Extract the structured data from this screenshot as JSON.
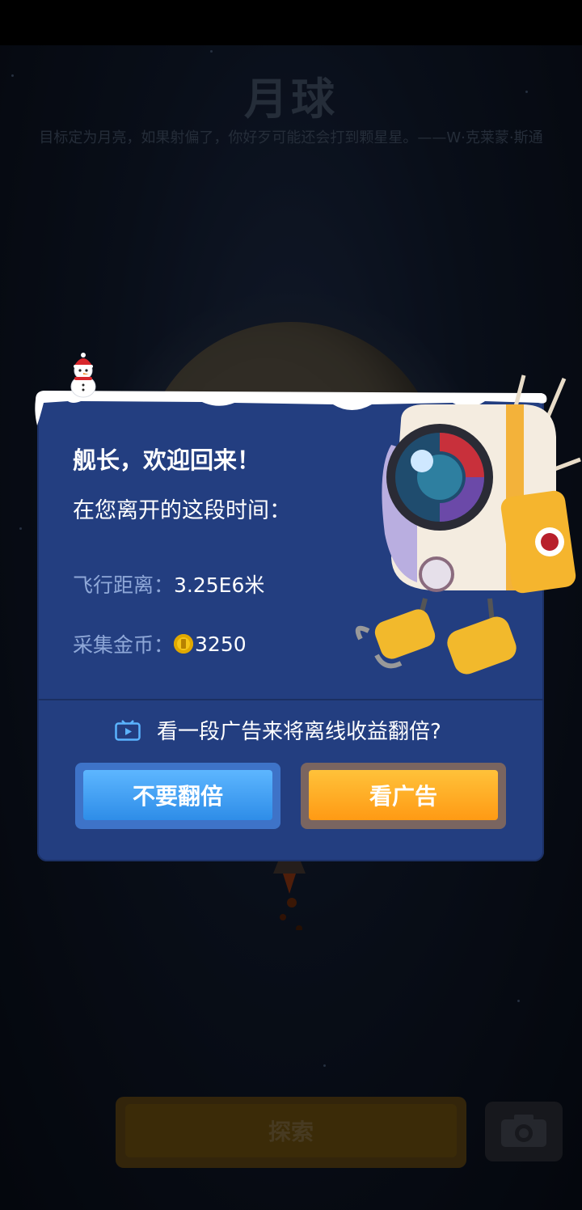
{
  "background": {
    "planet_title": "月球",
    "quote": "目标定为月亮，如果射偏了，你好歹可能还会打到颗星星。——W·克莱蒙·斯通",
    "explore_label": "探索",
    "camera_icon": "camera-icon"
  },
  "dialog": {
    "welcome": "舰长，欢迎回来！",
    "subtitle": "在您离开的这段时间：",
    "distance_label": "飞行距离：",
    "distance_value": "3.25E6米",
    "coins_label": "采集金币：",
    "coins_value": "3250",
    "ad_prompt": "看一段广告来将离线收益翻倍?",
    "no_double_label": "不要翻倍",
    "watch_ad_label": "看广告"
  },
  "colors": {
    "dialog_bg": "#233e80",
    "blue_button": "#3d9cf5",
    "orange_button": "#ffab1f",
    "label_blue": "#8fa8d8"
  }
}
